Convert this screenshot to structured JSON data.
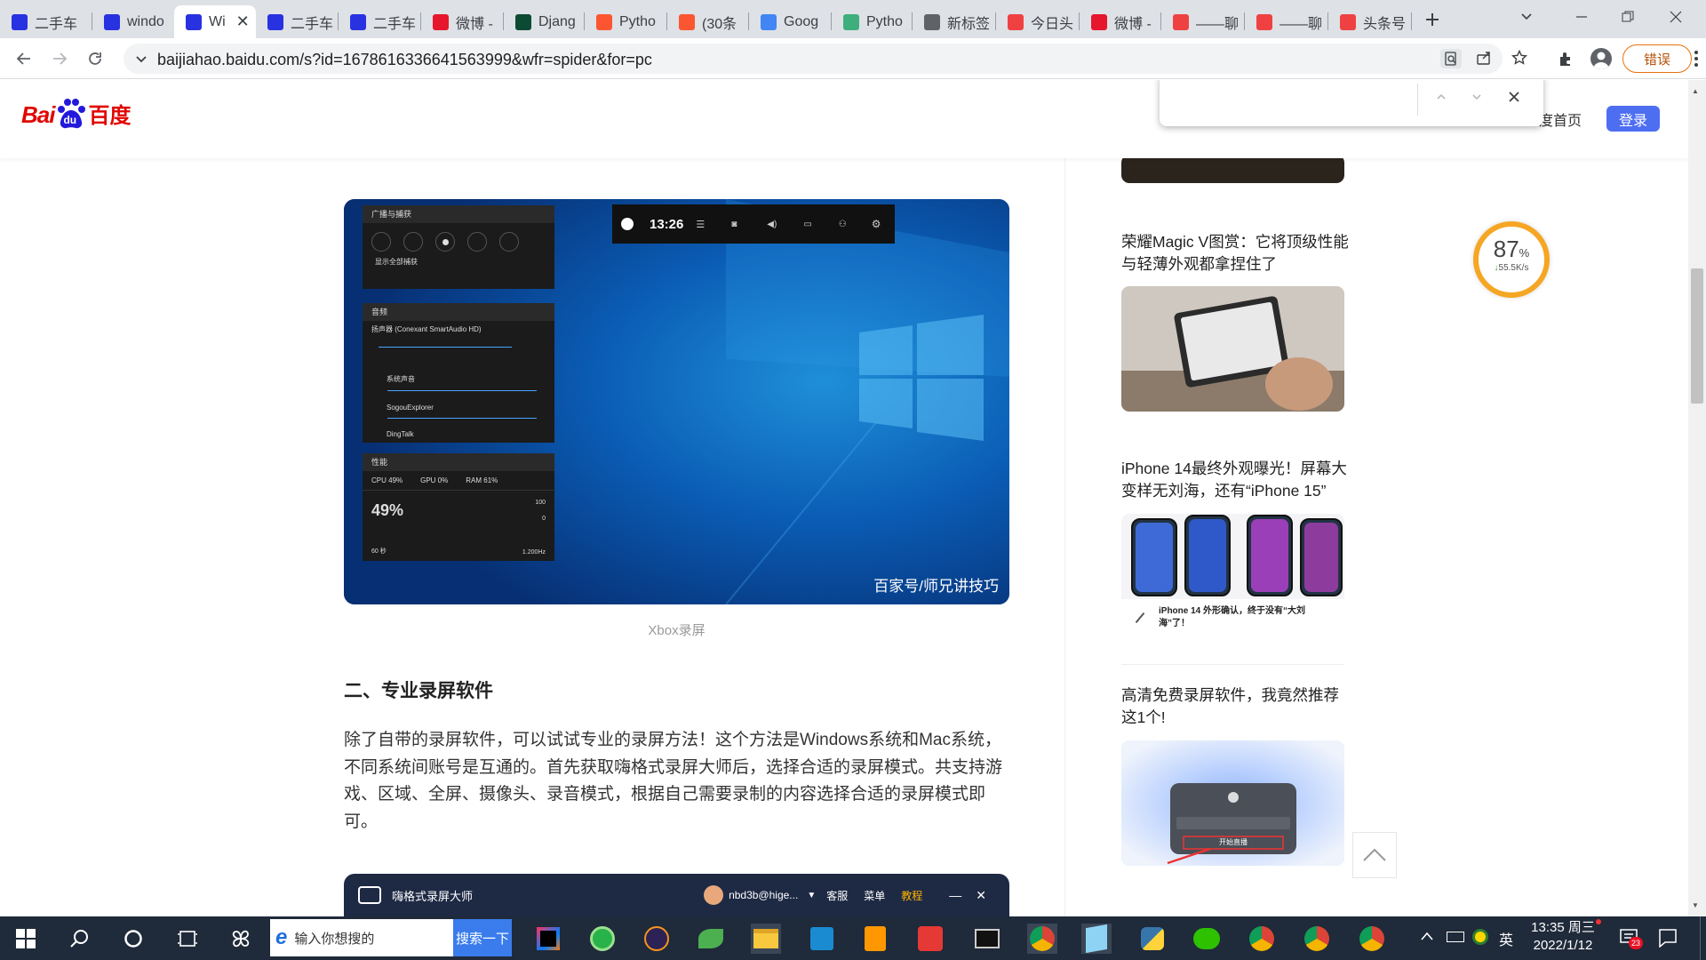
{
  "tabs": [
    {
      "title": "二手车",
      "icon": "baidu-paw-icon",
      "color": "#2932e1"
    },
    {
      "title": "windo",
      "icon": "baidu-paw-icon",
      "color": "#2932e1"
    },
    {
      "title": "Wi",
      "icon": "baidu-paw-icon",
      "color": "#2932e1",
      "active": true
    },
    {
      "title": "二手车",
      "icon": "baidu-paw-icon",
      "color": "#2932e1"
    },
    {
      "title": "二手车",
      "icon": "baidu-paw-icon",
      "color": "#2932e1"
    },
    {
      "title": "微博 -",
      "icon": "weibo-icon",
      "color": "#e6162d"
    },
    {
      "title": "Djang",
      "icon": "django-icon",
      "color": "#0c4b33"
    },
    {
      "title": "Pytho",
      "icon": "csdn-icon",
      "color": "#fc5531"
    },
    {
      "title": "(30条",
      "icon": "csdn-icon",
      "color": "#fc5531"
    },
    {
      "title": "Goog",
      "icon": "translate-icon",
      "color": "#4285f4"
    },
    {
      "title": "Pytho",
      "icon": "python-icon",
      "color": "#3eaf7c"
    },
    {
      "title": "新标签",
      "icon": "chrome-icon",
      "color": "#5f6368"
    },
    {
      "title": "今日头",
      "icon": "toutiao-icon",
      "color": "#f04142"
    },
    {
      "title": "微博 -",
      "icon": "weibo-icon",
      "color": "#e6162d"
    },
    {
      "title": "——聊",
      "icon": "toutiao-icon",
      "color": "#f04142"
    },
    {
      "title": "——聊",
      "icon": "toutiao-icon",
      "color": "#f04142"
    },
    {
      "title": "头条号",
      "icon": "toutiao-icon",
      "color": "#f04142"
    }
  ],
  "browser": {
    "url": "baijiahao.baidu.com/s?id=1678616336641563999&wfr=spider&for=pc",
    "error_badge": "错误",
    "find_value": ""
  },
  "site": {
    "logo_bai": "Bai",
    "logo_du": "du",
    "logo_cn": "百度",
    "home_link": "度首页",
    "login": "登录"
  },
  "article": {
    "figure1": {
      "caption": "Xbox录屏",
      "time": "13:26",
      "watermark": "百家号/师兄讲技巧",
      "panel_capture": "广播与捕获",
      "show_all": "显示全部捕获",
      "panel_audio": "音频",
      "device": "扬声器 (Conexant SmartAudio HD)",
      "app1": "系统声音",
      "app2": "SogouExplorer",
      "app3": "DingTalk",
      "panel_perf": "性能",
      "cpu": "CPU 49%",
      "gpu": "GPU 0%",
      "ram": "RAM 61%",
      "big_pct": "49%",
      "ymax": "100",
      "ymin": "0",
      "span": "60 秒",
      "freq": "1.200Hz"
    },
    "heading": "二、专业录屏软件",
    "paragraph": "除了自带的录屏软件，可以试试专业的录屏方法！这个方法是Windows系统和Mac系统，不同系统间账号是互通的。首先获取嗨格式录屏大师后，选择合适的录屏模式。共支持游戏、区域、全屏、摄像头、录音模式，根据自己需要录制的内容选择合适的录屏模式即可。",
    "figure2": {
      "app_name": "嗨格式录屏大师",
      "user": "nbd3b@hige...",
      "menu1": "客服",
      "menu2": "菜单",
      "menu3": "教程"
    }
  },
  "sidebar": [
    {
      "title": "荣耀Magic V图赏：它将顶级性能与轻薄外观都拿捏住了"
    },
    {
      "title": "iPhone 14最终外观曝光！屏幕大变样无刘海，还有“iPhone 15”",
      "thumb_caption": "iPhone 14 外形确认，终于没有“大刘海”了！"
    },
    {
      "title": "高清免费录屏软件，我竟然推荐这1个!",
      "thumb_text": "开始直播"
    }
  ],
  "speed_widget": {
    "percent": "87",
    "unit": "%",
    "speed": "55.5K/s"
  },
  "taskbar": {
    "search_placeholder": "输入你想搜的",
    "search_button": "搜索一下",
    "ime": "英",
    "time": "13:35 周三",
    "date": "2022/1/12",
    "notif_count": "23"
  }
}
